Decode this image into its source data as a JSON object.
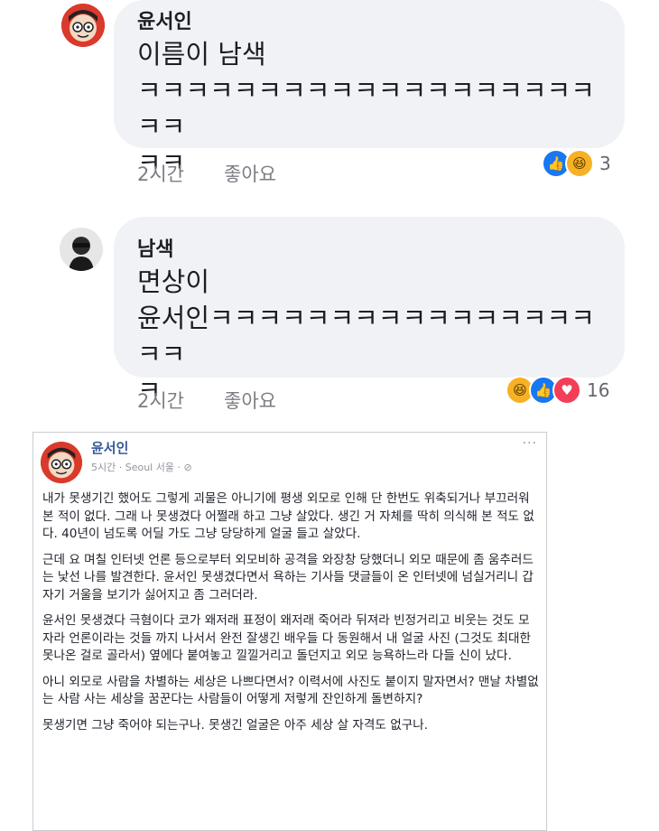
{
  "comments": [
    {
      "author": "윤서인",
      "text": "이름이 남색\nㅋㅋㅋㅋㅋㅋㅋㅋㅋㅋㅋㅋㅋㅋㅋㅋㅋㅋㅋㅋㅋ\nㅋㅋ",
      "time": "2시간",
      "like_label": "좋아요",
      "reaction_count": "3"
    },
    {
      "author": "남색",
      "text": "면상이\n윤서인ㅋㅋㅋㅋㅋㅋㅋㅋㅋㅋㅋㅋㅋㅋㅋㅋㅋㅋ\nㅋ",
      "time": "2시간",
      "like_label": "좋아요",
      "reaction_count": "16"
    }
  ],
  "post": {
    "author": "윤서인",
    "meta": "5시간 · Seoul 서울 · ⊘",
    "more": "···",
    "paragraphs": [
      "내가 못생기긴 했어도 그렇게 괴물은 아니기에 평생 외모로 인해 단 한번도 위축되거나 부끄러워 본 적이 없다. 그래 나 못생겼다 어쩔래 하고 그냥 살았다. 생긴 거 자체를 딱히 의식해 본 적도 없다. 40년이 넘도록 어딜 가도 그냥 당당하게 얼굴 들고 살았다.",
      "근데 요 며칠 인터넷 언론 등으로부터 외모비하 공격을 와장창 당했더니 외모 때문에 좀 움추러드는 낯선 나를 발견한다. 윤서인 못생겼다면서 욕하는 기사들 댓글들이 온 인터넷에 넘실거리니 갑자기 거울을 보기가 싫어지고 좀 그러더라.",
      "윤서인 못생겼다 극혐이다 코가 왜저래 표정이 왜저래 죽어라 뒤져라 빈정거리고 비웃는 것도 모자라 언론이라는 것들 까지 나서서 완전 잘생긴 배우들 다 동원해서 내 얼굴 사진 (그것도 최대한 못나온 걸로 골라서) 옆에다 붙여놓고 낄낄거리고 돌던지고 외모 능욕하느라 다들 신이 났다.",
      "아니 외모로 사람을 차별하는 세상은 나쁘다면서? 이력서에 사진도 붙이지 말자면서? 맨날 차별없는 사람 사는 세상을 꿈꾼다는 사람들이 어떻게 저렇게 잔인하게 돌변하지?",
      "못생기면 그냥 죽어야 되는구나. 못생긴 얼굴은 아주 세상 살 자격도 없구나."
    ]
  },
  "colors": {
    "bubble": "#f0f2f5",
    "like": "#1877f2",
    "haha": "#f7b125",
    "love": "#f33e58"
  }
}
